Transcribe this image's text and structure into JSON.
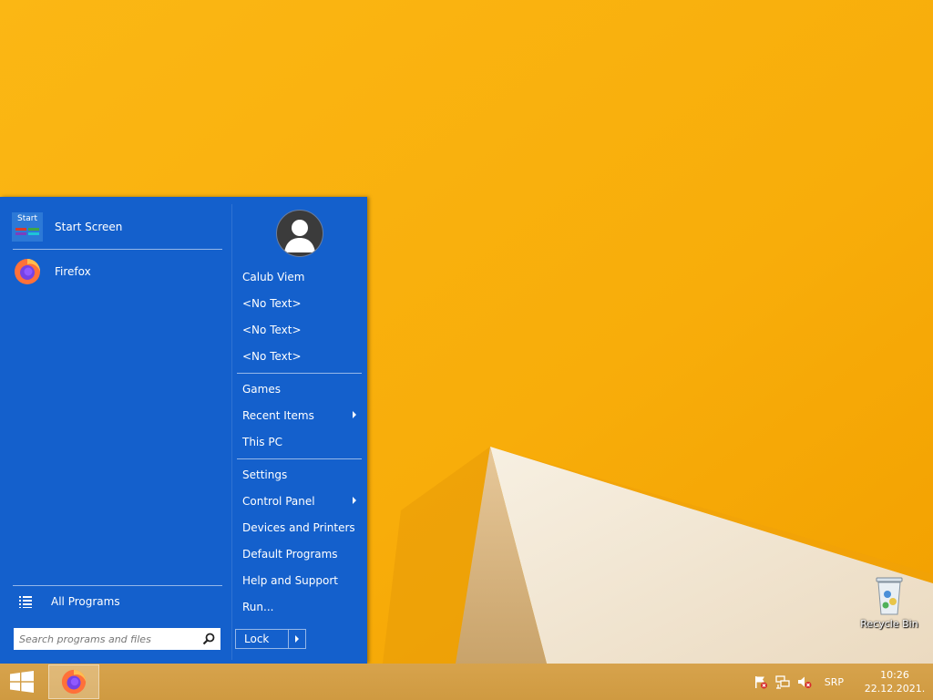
{
  "start_menu": {
    "pinned": [
      {
        "label": "Start Screen",
        "icon": "start-screen-icon",
        "tile_text": "Start"
      },
      {
        "label": "Firefox",
        "icon": "firefox-icon"
      }
    ],
    "all_programs": "All Programs",
    "search": {
      "placeholder": "Search programs and files"
    },
    "user_name": "Calub Viem",
    "right_items": [
      {
        "label": "<No Text>"
      },
      {
        "label": "<No Text>"
      },
      {
        "label": "<No Text>"
      },
      {
        "label": "Games"
      },
      {
        "label": "Recent Items",
        "submenu": true
      },
      {
        "label": "This PC"
      },
      {
        "label": "Settings"
      },
      {
        "label": "Control Panel",
        "submenu": true
      },
      {
        "label": "Devices and Printers"
      },
      {
        "label": "Default Programs"
      },
      {
        "label": "Help and Support"
      },
      {
        "label": "Run..."
      }
    ],
    "lock_label": "Lock"
  },
  "desktop": {
    "recycle_bin_label": "Recycle Bin"
  },
  "taskbar": {
    "language": "SRP",
    "time": "10:26",
    "date": "22.12.2021."
  },
  "colors": {
    "menu_bg": "#1460cc",
    "wallpaper": "#f9b20e",
    "taskbar": "#d4a047"
  }
}
